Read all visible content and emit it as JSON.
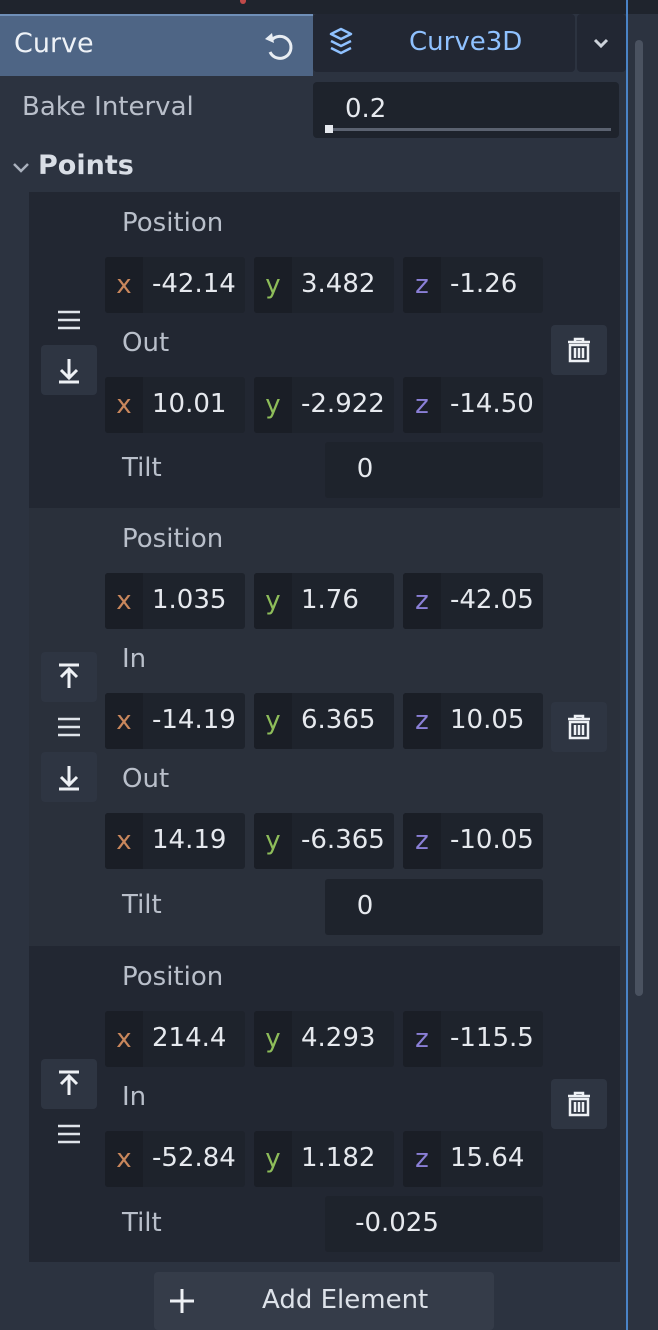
{
  "header": {
    "property_label": "Curve",
    "resource_type": "Curve3D"
  },
  "bake_interval": {
    "label": "Bake Interval",
    "value": "0.2"
  },
  "points": {
    "label": "Points",
    "elements": [
      {
        "position": {
          "label": "Position",
          "x": "-42.14",
          "y": "3.482",
          "z": "-1.26"
        },
        "out": {
          "label": "Out",
          "x": "10.01",
          "y": "-2.922",
          "z": "-14.50"
        },
        "tilt": {
          "label": "Tilt",
          "value": "0"
        }
      },
      {
        "position": {
          "label": "Position",
          "x": "1.035",
          "y": "1.76",
          "z": "-42.05"
        },
        "in": {
          "label": "In",
          "x": "-14.19",
          "y": "6.365",
          "z": "10.05"
        },
        "out": {
          "label": "Out",
          "x": "14.19",
          "y": "-6.365",
          "z": "-10.05"
        },
        "tilt": {
          "label": "Tilt",
          "value": "0"
        }
      },
      {
        "position": {
          "label": "Position",
          "x": "214.4",
          "y": "4.293",
          "z": "-115.5"
        },
        "in": {
          "label": "In",
          "x": "-52.84",
          "y": "1.182",
          "z": "15.64"
        },
        "tilt": {
          "label": "Tilt",
          "value": "-0.025"
        }
      }
    ]
  },
  "axes": {
    "x": "x",
    "y": "y",
    "z": "z"
  },
  "add_element_label": "Add Element",
  "icons": {
    "revert": "revert-icon",
    "resource": "curve3d-resource-icon",
    "dropdown": "chevron-down-icon",
    "collapse": "chevron-down-icon",
    "drag": "drag-handle-icon",
    "move_up": "move-up-icon",
    "move_down": "move-down-icon",
    "delete": "trash-icon",
    "add": "plus-icon"
  },
  "colors": {
    "accent": "#8fc1ff",
    "axis_x": "#c9875c",
    "axis_y": "#8ebd5a",
    "axis_z": "#8a7fd6"
  }
}
